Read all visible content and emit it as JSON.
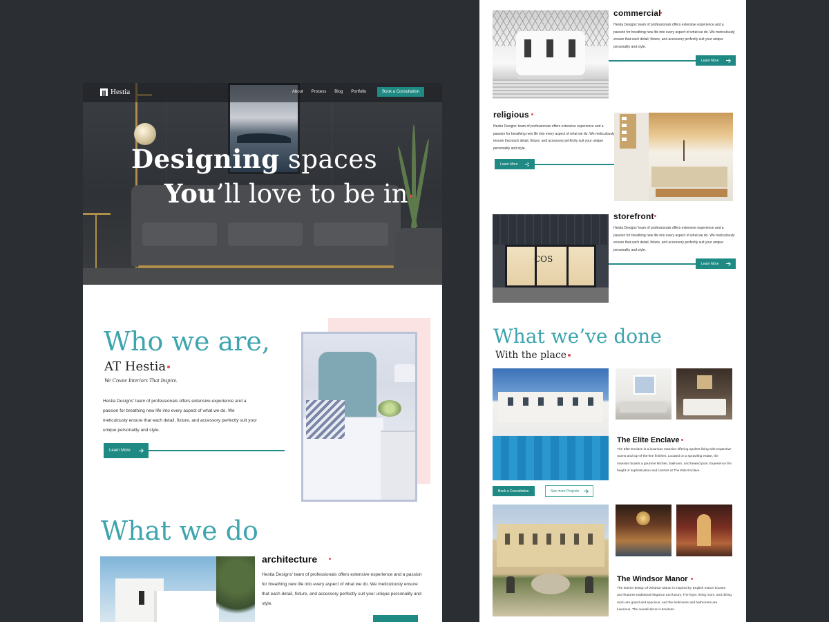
{
  "colors": {
    "background": "#2b2f33",
    "accent": "#1f8a83",
    "heading_teal": "#3ea4ad",
    "dot_red": "#e24b4b",
    "pink_block": "#fbe3e3"
  },
  "nav": {
    "logo": "Hestia",
    "links": [
      "About",
      "Process",
      "Blog",
      "Portfolio"
    ],
    "cta": "Book a Consultation"
  },
  "hero": {
    "line1_bold": "Designing",
    "line1_rest": " spaces",
    "line2_bold": "You",
    "line2_rest": "’ll love to be in"
  },
  "who": {
    "title": "Who we are,",
    "subtitle": "AT Hestia",
    "tagline": "We Create Interiors That Inspire.",
    "body": "Hestia Designs' team of professionals offers extensive experience and a passion for breathing new life into every aspect of what we do. We meticulously ensure that each detail, fixture, and accessory perfectly suit your unique personality and style.",
    "button": "Learn More"
  },
  "what_we_do": {
    "title": "What we do",
    "items": [
      {
        "title": "architecture",
        "body": "Hestia Designs' team of professionals offers extensive experience and a passion for breathing new life into every aspect of what we do. We meticulously ensure that each detail, fixture, and accessory perfectly suit your unique personality and style."
      },
      {
        "title": "commercial",
        "body": "Hestia Designs' team of professionals offers extensive experience and a passion for breathing new life into every aspect of what we do. We meticulously ensure that each detail, fixture, and accessory perfectly suit your unique personality and style.",
        "button": "Learn More"
      },
      {
        "title": "religious",
        "body": "Hestia Designs' team of professionals offers extensive experience and a passion for breathing new life into every aspect of what we do. We meticulously ensure that each detail, fixture, and accessory perfectly suit your unique personality and style.",
        "button": "Learn More"
      },
      {
        "title": "storefront",
        "body": "Hestia Designs' team of professionals offers extensive experience and a passion for breathing new life into every aspect of what we do. We meticulously ensure that each detail, fixture, and accessory perfectly suit your unique personality and style.",
        "button": "Learn More"
      }
    ]
  },
  "done": {
    "title": "What we’ve done",
    "subtitle": "With the place",
    "projects": [
      {
        "title": "The Elite Enclave",
        "body": "The Elite Enclave is a luxurious mansion offering opulent living with expansive rooms and top-of-the-line finishes. Located on a sprawling estate, the mansion boasts a gourmet kitchen, ballroom, and heated pool. Experience the height of sophistication and comfort at The Elite Enclave.",
        "primary": "Book a Consultation",
        "secondary": "See more Projects"
      },
      {
        "title": "The Windsor Manor",
        "body": "The interior design of Windsor Manor is inspired by English manor houses and features traditional elegance and luxury. The foyer, living room, and dining room are grand and spacious, and the bedrooms and bathrooms are luxurious. The overall decor is timeless."
      }
    ]
  }
}
